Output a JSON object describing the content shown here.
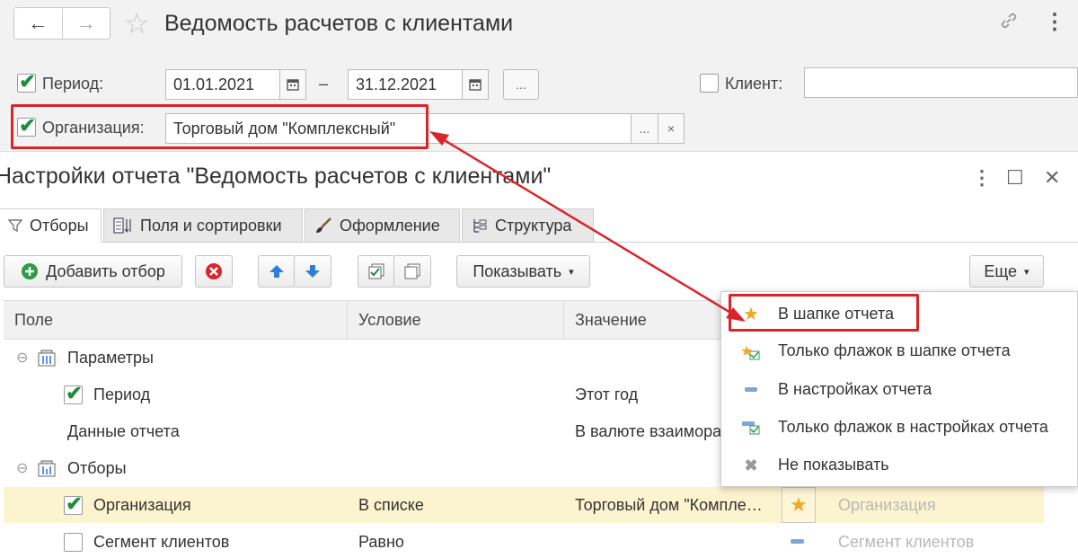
{
  "header": {
    "title": "Ведомость расчетов с клиентами",
    "back_icon": "←",
    "forward_icon": "→",
    "star_icon": "☆",
    "link_icon": "⛓",
    "more_icon": "⋮"
  },
  "filters": {
    "period_label": "Период:",
    "date_from": "01.01.2021",
    "dash": "–",
    "date_to": "31.12.2021",
    "dots": "...",
    "client_label": "Клиент:",
    "client_value": "",
    "org_label": "Организация:",
    "org_value": "Торговый дом \"Комплексный\"",
    "clear": "×",
    "check": "✔"
  },
  "dialog": {
    "title": "Настройки отчета \"Ведомость расчетов с клиентами\"",
    "more": "⋮",
    "maximize": "☐",
    "close": "✕",
    "tabs": [
      {
        "label": "Отборы"
      },
      {
        "label": "Поля и сортировки"
      },
      {
        "label": "Оформление"
      },
      {
        "label": "Структура"
      }
    ],
    "toolbar": {
      "add_filter": "Добавить отбор",
      "show": "Показывать",
      "more": "Еще"
    },
    "table": {
      "headers": [
        "Поле",
        "Условие",
        "Значение"
      ],
      "rows": [
        {
          "field": "Параметры",
          "condition": "",
          "value": "",
          "group": true
        },
        {
          "field": "Период",
          "condition": "",
          "value": "Этот год",
          "checked": true
        },
        {
          "field": "Данные отчета",
          "condition": "",
          "value": "В валюте взаимора"
        },
        {
          "field": "Отборы",
          "condition": "",
          "value": "",
          "group": true
        },
        {
          "field": "Организация",
          "condition": "В списке",
          "value": "Торговый дом \"Компле…",
          "checked": true,
          "display": "Организация"
        },
        {
          "field": "Сегмент клиентов",
          "condition": "Равно",
          "value": "",
          "checked": false,
          "display": "Сегмент клиентов"
        }
      ]
    }
  },
  "popup": {
    "items": [
      {
        "label": "В шапке отчета",
        "icon": "star-icon"
      },
      {
        "label": "Только флажок в шапке отчета",
        "icon": "star-check-icon"
      },
      {
        "label": "В настройках отчета",
        "icon": "dash-icon"
      },
      {
        "label": "Только флажок в настройках отчета",
        "icon": "dash-check-icon"
      },
      {
        "label": "Не показывать",
        "icon": "cross-icon"
      }
    ]
  },
  "colors": {
    "highlight": "#d9252a",
    "check_green": "#1a8f3c",
    "row_highlight": "#fcf3cf",
    "star": "#f0a825",
    "arrow_blue": "#2f7fd6"
  }
}
